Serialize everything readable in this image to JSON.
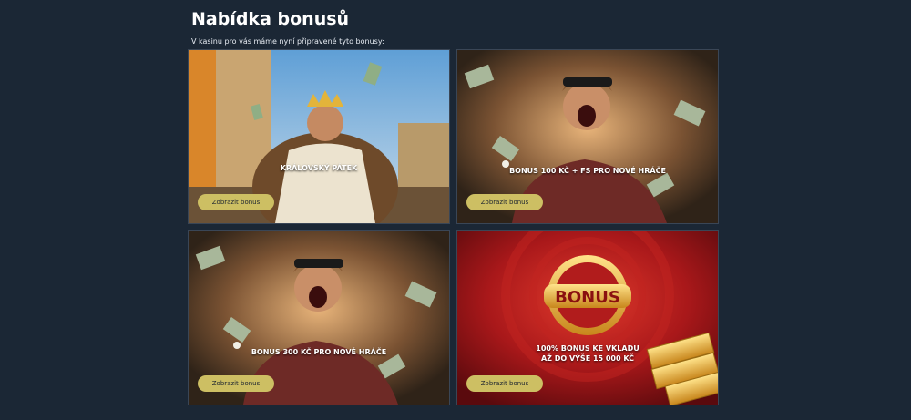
{
  "header": {
    "title": "Nabídka bonusů",
    "subtitle": "V kasinu pro vás máme nyní připravené tyto bonusy:"
  },
  "cards": [
    {
      "title": "KRÁLOVSKÝ PÁTEK",
      "button_label": "Zobrazit bonus",
      "image": "man-in-white-suit-with-crown-throwing-money"
    },
    {
      "title": "BONUS 100 Kč + FS PRO NOVÉ HRÁČE",
      "button_label": "Zobrazit bonus",
      "image": "excited-man-with-glasses-flying-banknotes"
    },
    {
      "title": "BONUS 300 Kč PRO NOVÉ HRÁČE",
      "button_label": "Zobrazit bonus",
      "image": "excited-man-with-glasses-flying-banknotes"
    },
    {
      "title_line1": "100% BONUS KE VKLADU",
      "title_line2": "AŽ DO VÝŠE 15 000 Kč",
      "badge_text": "BONUS",
      "button_label": "Zobrazit bonus",
      "image": "bonus-badge-gold-bars-red-background"
    }
  ],
  "colors": {
    "background": "#1b2735",
    "button": "#cdbf63",
    "button_text": "#1e2530"
  }
}
